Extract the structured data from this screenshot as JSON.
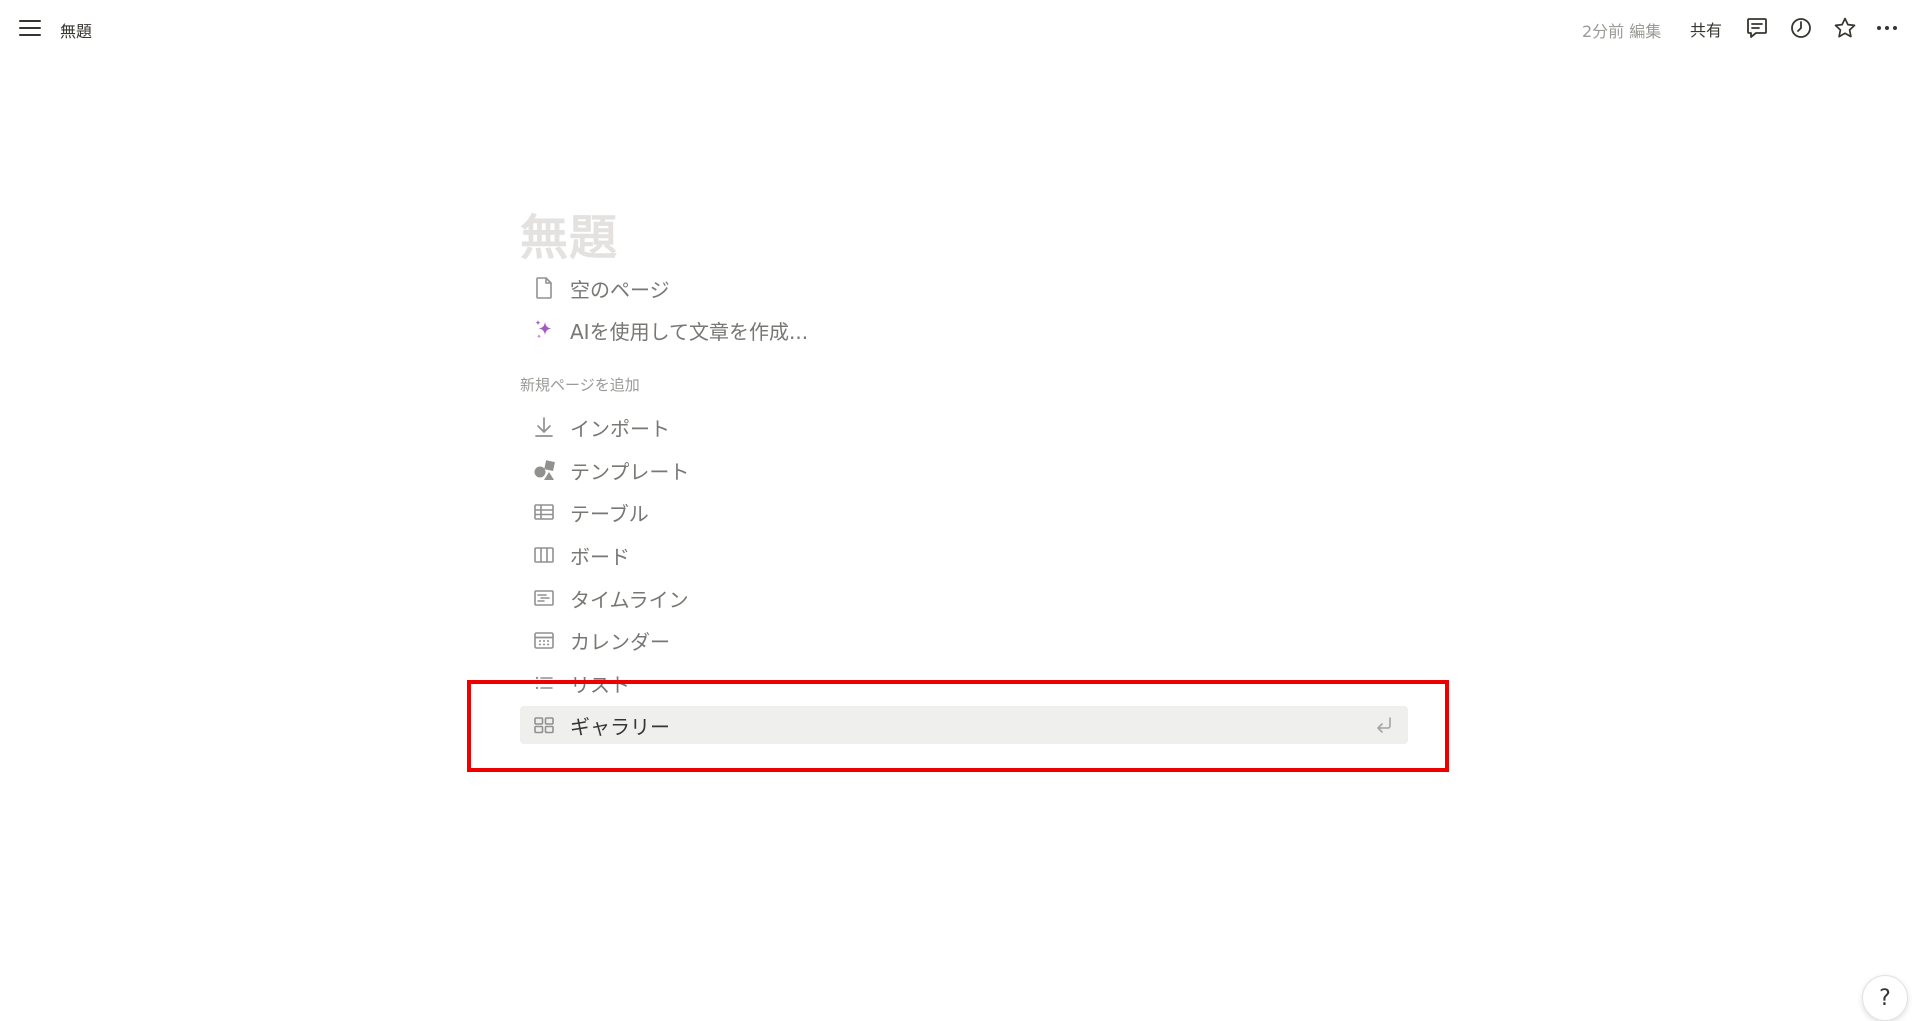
{
  "topbar": {
    "page_name": "無題",
    "edited": "2分前 編集",
    "share_label": "共有"
  },
  "page": {
    "title": "無題",
    "quick_options": [
      {
        "label": "空のページ",
        "icon": "document-icon"
      },
      {
        "label": "AIを使用して文章を作成...",
        "icon": "ai-sparkle-icon"
      }
    ],
    "section_label": "新規ページを追加",
    "add_options": [
      {
        "label": "インポート",
        "icon": "import-icon"
      },
      {
        "label": "テンプレート",
        "icon": "template-icon"
      },
      {
        "label": "テーブル",
        "icon": "table-icon"
      },
      {
        "label": "ボード",
        "icon": "board-icon"
      },
      {
        "label": "タイムライン",
        "icon": "timeline-icon"
      },
      {
        "label": "カレンダー",
        "icon": "calendar-icon"
      },
      {
        "label": "リスト",
        "icon": "list-icon"
      },
      {
        "label": "ギャラリー",
        "icon": "gallery-icon"
      }
    ],
    "selected_option": "ギャラリー"
  },
  "help_label": "?",
  "colors": {
    "text": "#37352f",
    "muted": "#787774",
    "title_placeholder": "#e3e2e0",
    "selected_bg": "#efefed",
    "highlight_border": "#ee0000",
    "ai_accent": "#a05bc5"
  }
}
